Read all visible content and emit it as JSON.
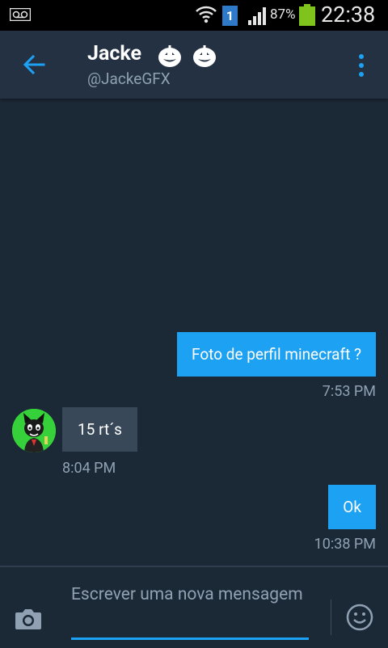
{
  "status_bar": {
    "sim_number": "1",
    "battery_percent": "87%",
    "battery_level": 0.87,
    "time": "22:38",
    "icons": [
      "voicemail-icon",
      "wifi-icon",
      "signal-icon",
      "battery-icon"
    ]
  },
  "header": {
    "name": "Jacke",
    "handle": "@JackeGFX",
    "name_emojis": [
      "pumpkin-icon",
      "pumpkin-icon"
    ]
  },
  "messages": [
    {
      "direction": "outgoing",
      "text": "Foto de perfil minecraft ?",
      "time": "7:53 PM"
    },
    {
      "direction": "incoming",
      "text": "15 rt´s",
      "time": "8:04 PM"
    },
    {
      "direction": "outgoing",
      "text": "Ok",
      "time": "10:38 PM"
    }
  ],
  "composer": {
    "placeholder": "Escrever uma nova mensagem",
    "value": ""
  },
  "colors": {
    "background": "#1b2836",
    "app_bar": "#233142",
    "accent": "#1da1f2",
    "incoming_bubble": "#384858",
    "secondary_text": "#8fa1b3",
    "battery": "#7fc31c"
  }
}
